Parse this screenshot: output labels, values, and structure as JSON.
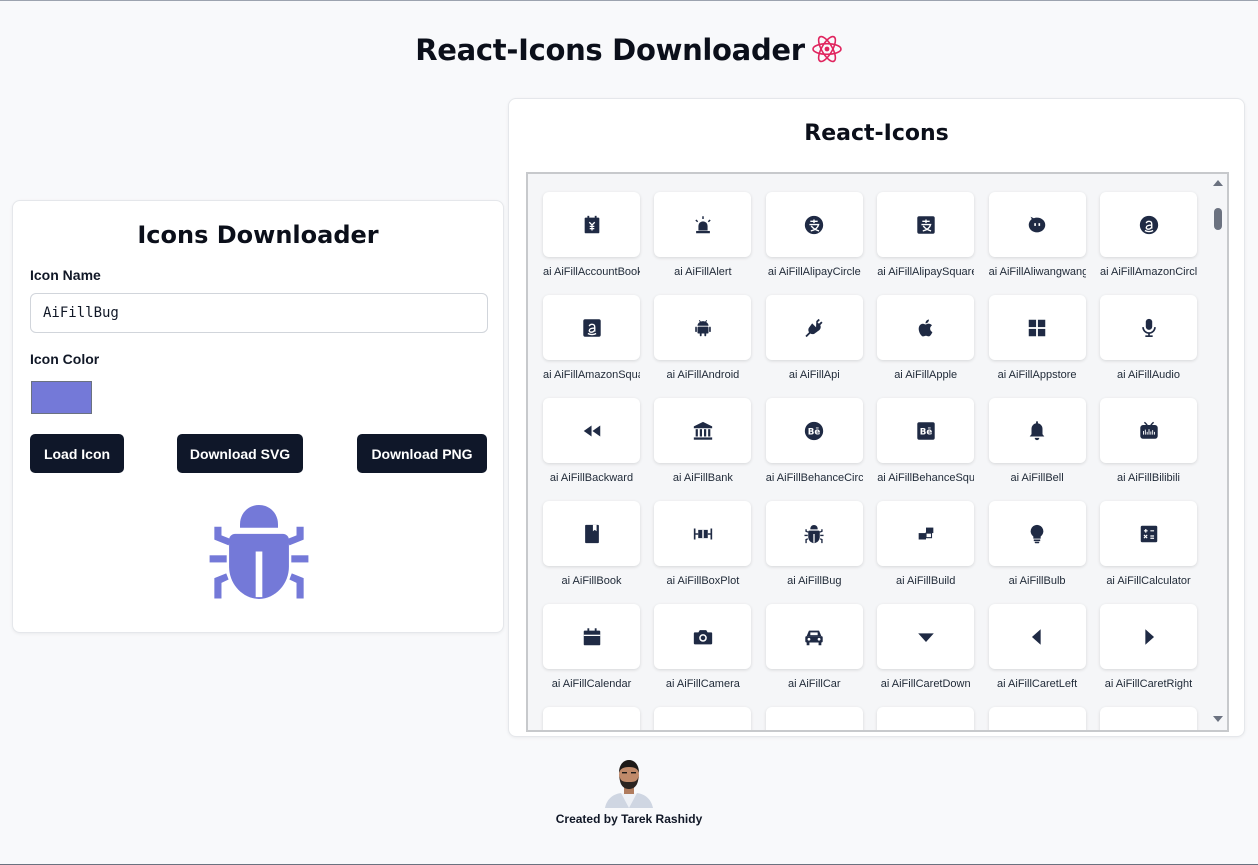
{
  "header": {
    "title": "React-Icons Downloader"
  },
  "downloader": {
    "title": "Icons Downloader",
    "name_label": "Icon Name",
    "name_value": "AiFillBug",
    "color_label": "Icon Color",
    "color_value": "#7479d8",
    "load_label": "Load Icon",
    "svg_label": "Download SVG",
    "png_label": "Download PNG",
    "preview_icon": "bug-icon"
  },
  "browser": {
    "title": "React-Icons",
    "icons": [
      {
        "label": "ai AiFillAccountBook",
        "icon": "account-book-icon"
      },
      {
        "label": "ai AiFillAlert",
        "icon": "alert-icon"
      },
      {
        "label": "ai AiFillAlipayCircle",
        "icon": "alipay-circle-icon"
      },
      {
        "label": "ai AiFillAlipaySquare",
        "icon": "alipay-square-icon"
      },
      {
        "label": "ai AiFillAliwangwang",
        "icon": "aliwangwang-icon"
      },
      {
        "label": "ai AiFillAmazonCircle",
        "icon": "amazon-circle-icon"
      },
      {
        "label": "ai AiFillAmazonSquare",
        "icon": "amazon-square-icon"
      },
      {
        "label": "ai AiFillAndroid",
        "icon": "android-icon"
      },
      {
        "label": "ai AiFillApi",
        "icon": "api-icon"
      },
      {
        "label": "ai AiFillApple",
        "icon": "apple-icon"
      },
      {
        "label": "ai AiFillAppstore",
        "icon": "appstore-icon"
      },
      {
        "label": "ai AiFillAudio",
        "icon": "audio-icon"
      },
      {
        "label": "ai AiFillBackward",
        "icon": "backward-icon"
      },
      {
        "label": "ai AiFillBank",
        "icon": "bank-icon"
      },
      {
        "label": "ai AiFillBehanceCircle",
        "icon": "behance-circle-icon"
      },
      {
        "label": "ai AiFillBehanceSquare",
        "icon": "behance-square-icon"
      },
      {
        "label": "ai AiFillBell",
        "icon": "bell-icon"
      },
      {
        "label": "ai AiFillBilibili",
        "icon": "bilibili-icon"
      },
      {
        "label": "ai AiFillBook",
        "icon": "book-icon"
      },
      {
        "label": "ai AiFillBoxPlot",
        "icon": "box-plot-icon"
      },
      {
        "label": "ai AiFillBug",
        "icon": "bug-icon"
      },
      {
        "label": "ai AiFillBuild",
        "icon": "build-icon"
      },
      {
        "label": "ai AiFillBulb",
        "icon": "bulb-icon"
      },
      {
        "label": "ai AiFillCalculator",
        "icon": "calculator-icon"
      },
      {
        "label": "ai AiFillCalendar",
        "icon": "calendar-icon"
      },
      {
        "label": "ai AiFillCamera",
        "icon": "camera-icon"
      },
      {
        "label": "ai AiFillCar",
        "icon": "car-icon"
      },
      {
        "label": "ai AiFillCaretDown",
        "icon": "caret-down-icon"
      },
      {
        "label": "ai AiFillCaretLeft",
        "icon": "caret-left-icon"
      },
      {
        "label": "ai AiFillCaretRight",
        "icon": "caret-right-icon"
      }
    ]
  },
  "footer": {
    "credit": "Created by Tarek Rashidy"
  }
}
